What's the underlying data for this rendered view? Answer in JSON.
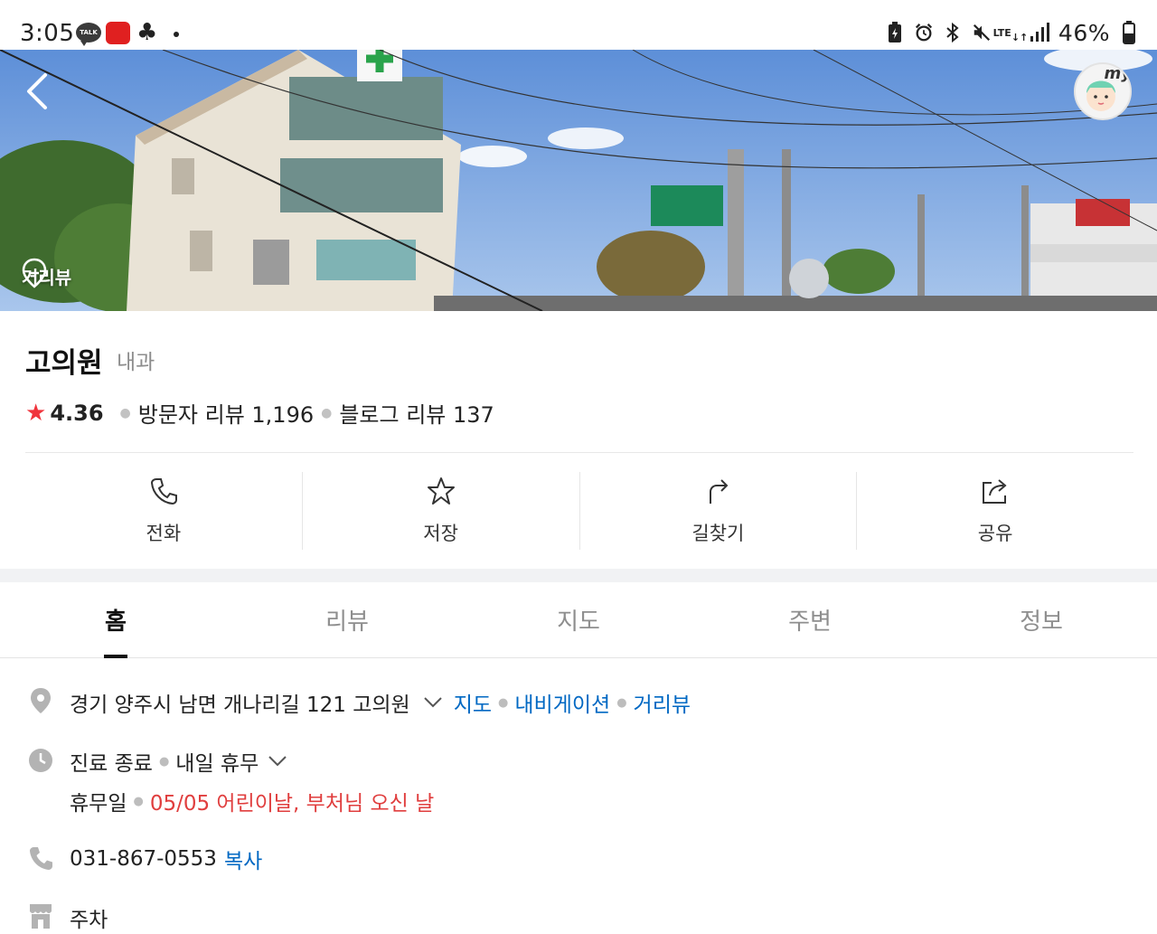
{
  "status_bar": {
    "time": "3:05",
    "talk_badge": "TALK",
    "network": "LTE",
    "battery": "46%"
  },
  "hero": {
    "streetview_label": "거리뷰",
    "my_label": "my"
  },
  "place": {
    "name": "고의원",
    "category": "내과",
    "rating": "4.36",
    "visitor_reviews": "방문자 리뷰 1,196",
    "blog_reviews": "블로그 리뷰 137"
  },
  "actions": [
    {
      "label": "전화",
      "icon": "phone-icon"
    },
    {
      "label": "저장",
      "icon": "star-outline-icon"
    },
    {
      "label": "길찾기",
      "icon": "directions-icon"
    },
    {
      "label": "공유",
      "icon": "share-icon"
    }
  ],
  "tabs": [
    {
      "label": "홈",
      "active": true
    },
    {
      "label": "리뷰",
      "active": false
    },
    {
      "label": "지도",
      "active": false
    },
    {
      "label": "주변",
      "active": false
    },
    {
      "label": "정보",
      "active": false
    }
  ],
  "info": {
    "address": "경기 양주시 남면 개나리길 121 고의원",
    "address_links": [
      "지도",
      "내비게이션",
      "거리뷰"
    ],
    "hours_status": "진료 종료",
    "hours_next": "내일 휴무",
    "holiday_label": "휴무일",
    "holiday_value": "05/05 어린이날, 부처님 오신 날",
    "phone": "031-867-0553",
    "copy_label": "복사",
    "parking": "주차"
  },
  "colors": {
    "link_blue": "#0068c3",
    "rating_star": "#f0343c",
    "holiday_red": "#e03e3e"
  }
}
